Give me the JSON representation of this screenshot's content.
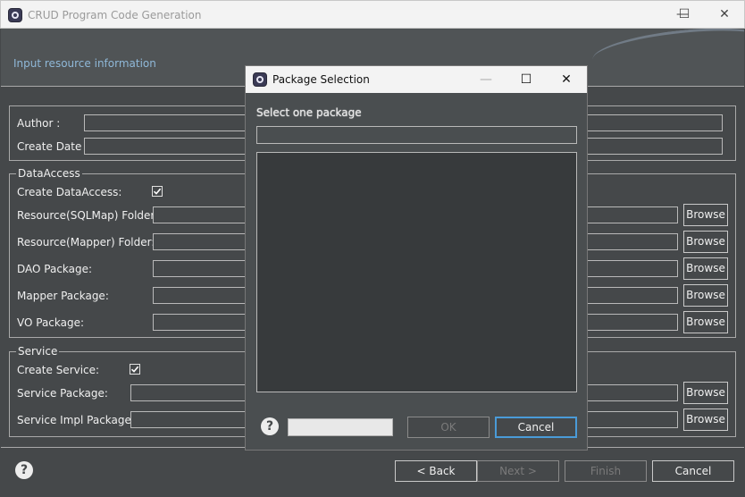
{
  "window": {
    "title": "CRUD Program Code Generation",
    "minimize": "—",
    "maximize": "☐",
    "close": "✕"
  },
  "header": {
    "subtitle": "Input resource information"
  },
  "author": {
    "author_label": "Author :",
    "create_date_label": "Create Date :"
  },
  "data_access": {
    "group_label": "DataAccess",
    "create_label": "Create DataAccess:",
    "create_checked": true,
    "rows": [
      {
        "label": "Resource(SQLMap) Folder:",
        "button": "Browse"
      },
      {
        "label": "Resource(Mapper) Folder:",
        "button": "Browse"
      },
      {
        "label": "DAO Package:",
        "button": "Browse"
      },
      {
        "label": "Mapper Package:",
        "button": "Browse"
      },
      {
        "label": "VO Package:",
        "button": "Browse"
      }
    ]
  },
  "service": {
    "group_label": "Service",
    "create_label": "Create Service:",
    "create_checked": true,
    "rows": [
      {
        "label": "Service Package:",
        "button": "Browse"
      },
      {
        "label": "Service Impl Package:",
        "button": "Browse"
      }
    ]
  },
  "footer": {
    "help": "?",
    "back": "< Back",
    "next": "Next >",
    "finish": "Finish",
    "cancel": "Cancel"
  },
  "dialog": {
    "title": "Package Selection",
    "minimize": "—",
    "maximize": "☐",
    "close": "✕",
    "prompt": "Select one package",
    "help": "?",
    "ok": "OK",
    "cancel": "Cancel"
  },
  "colors": {
    "background": "#45484a",
    "accent": "#4a9bd8",
    "header_text": "#8fb8d8"
  }
}
